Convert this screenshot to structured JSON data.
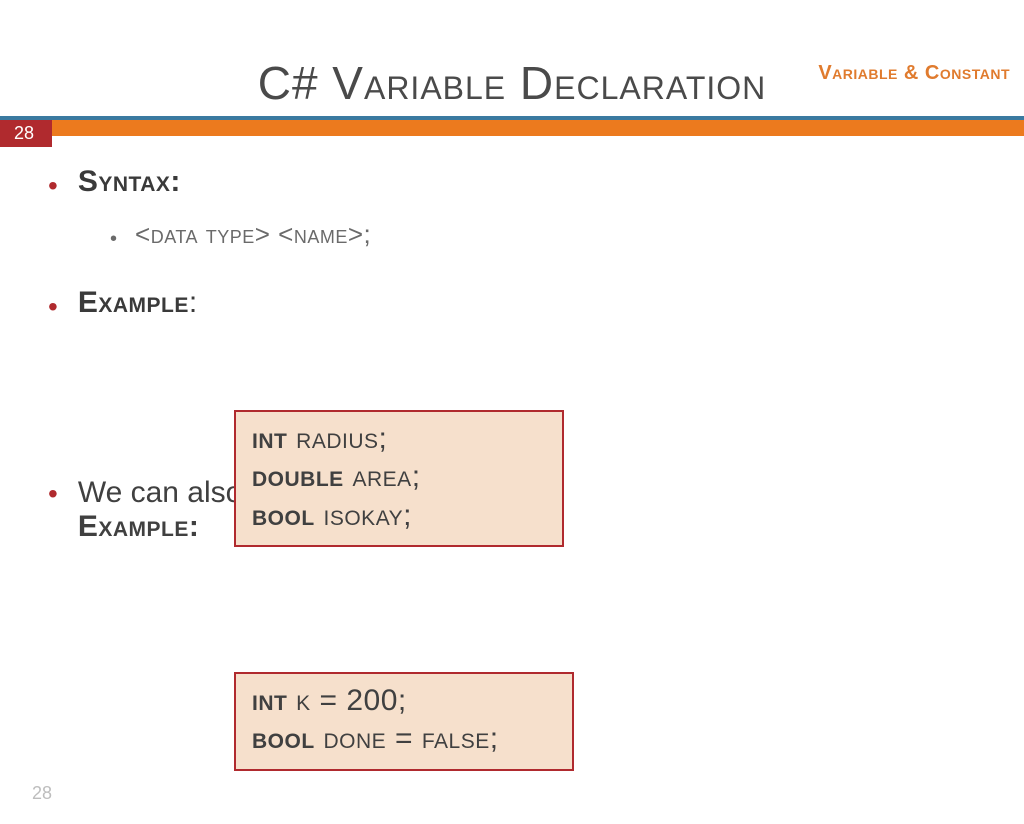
{
  "header": {
    "topic": "Variable & Constant"
  },
  "title": "C# Variable Declaration",
  "page_number_badge": "28",
  "bullets": {
    "syntax_label": "Syntax:",
    "syntax_pattern": "<data type> <name>;",
    "example_label": "Example",
    "assign_text": "We can also assign its initial value.",
    "assign_example_label": "Example:"
  },
  "code": {
    "box1": {
      "l1_kw": "int",
      "l1_rest": " radius;",
      "l2_kw": "double",
      "l2_rest": " area;",
      "l3_kw": "bool",
      "l3_rest": " isokay;"
    },
    "box2": {
      "l1_kw": "int",
      "l1_rest": " k = 200;",
      "l2_kw": "bool",
      "l2_rest": " done = false;"
    }
  },
  "footer": {
    "page": "28"
  }
}
